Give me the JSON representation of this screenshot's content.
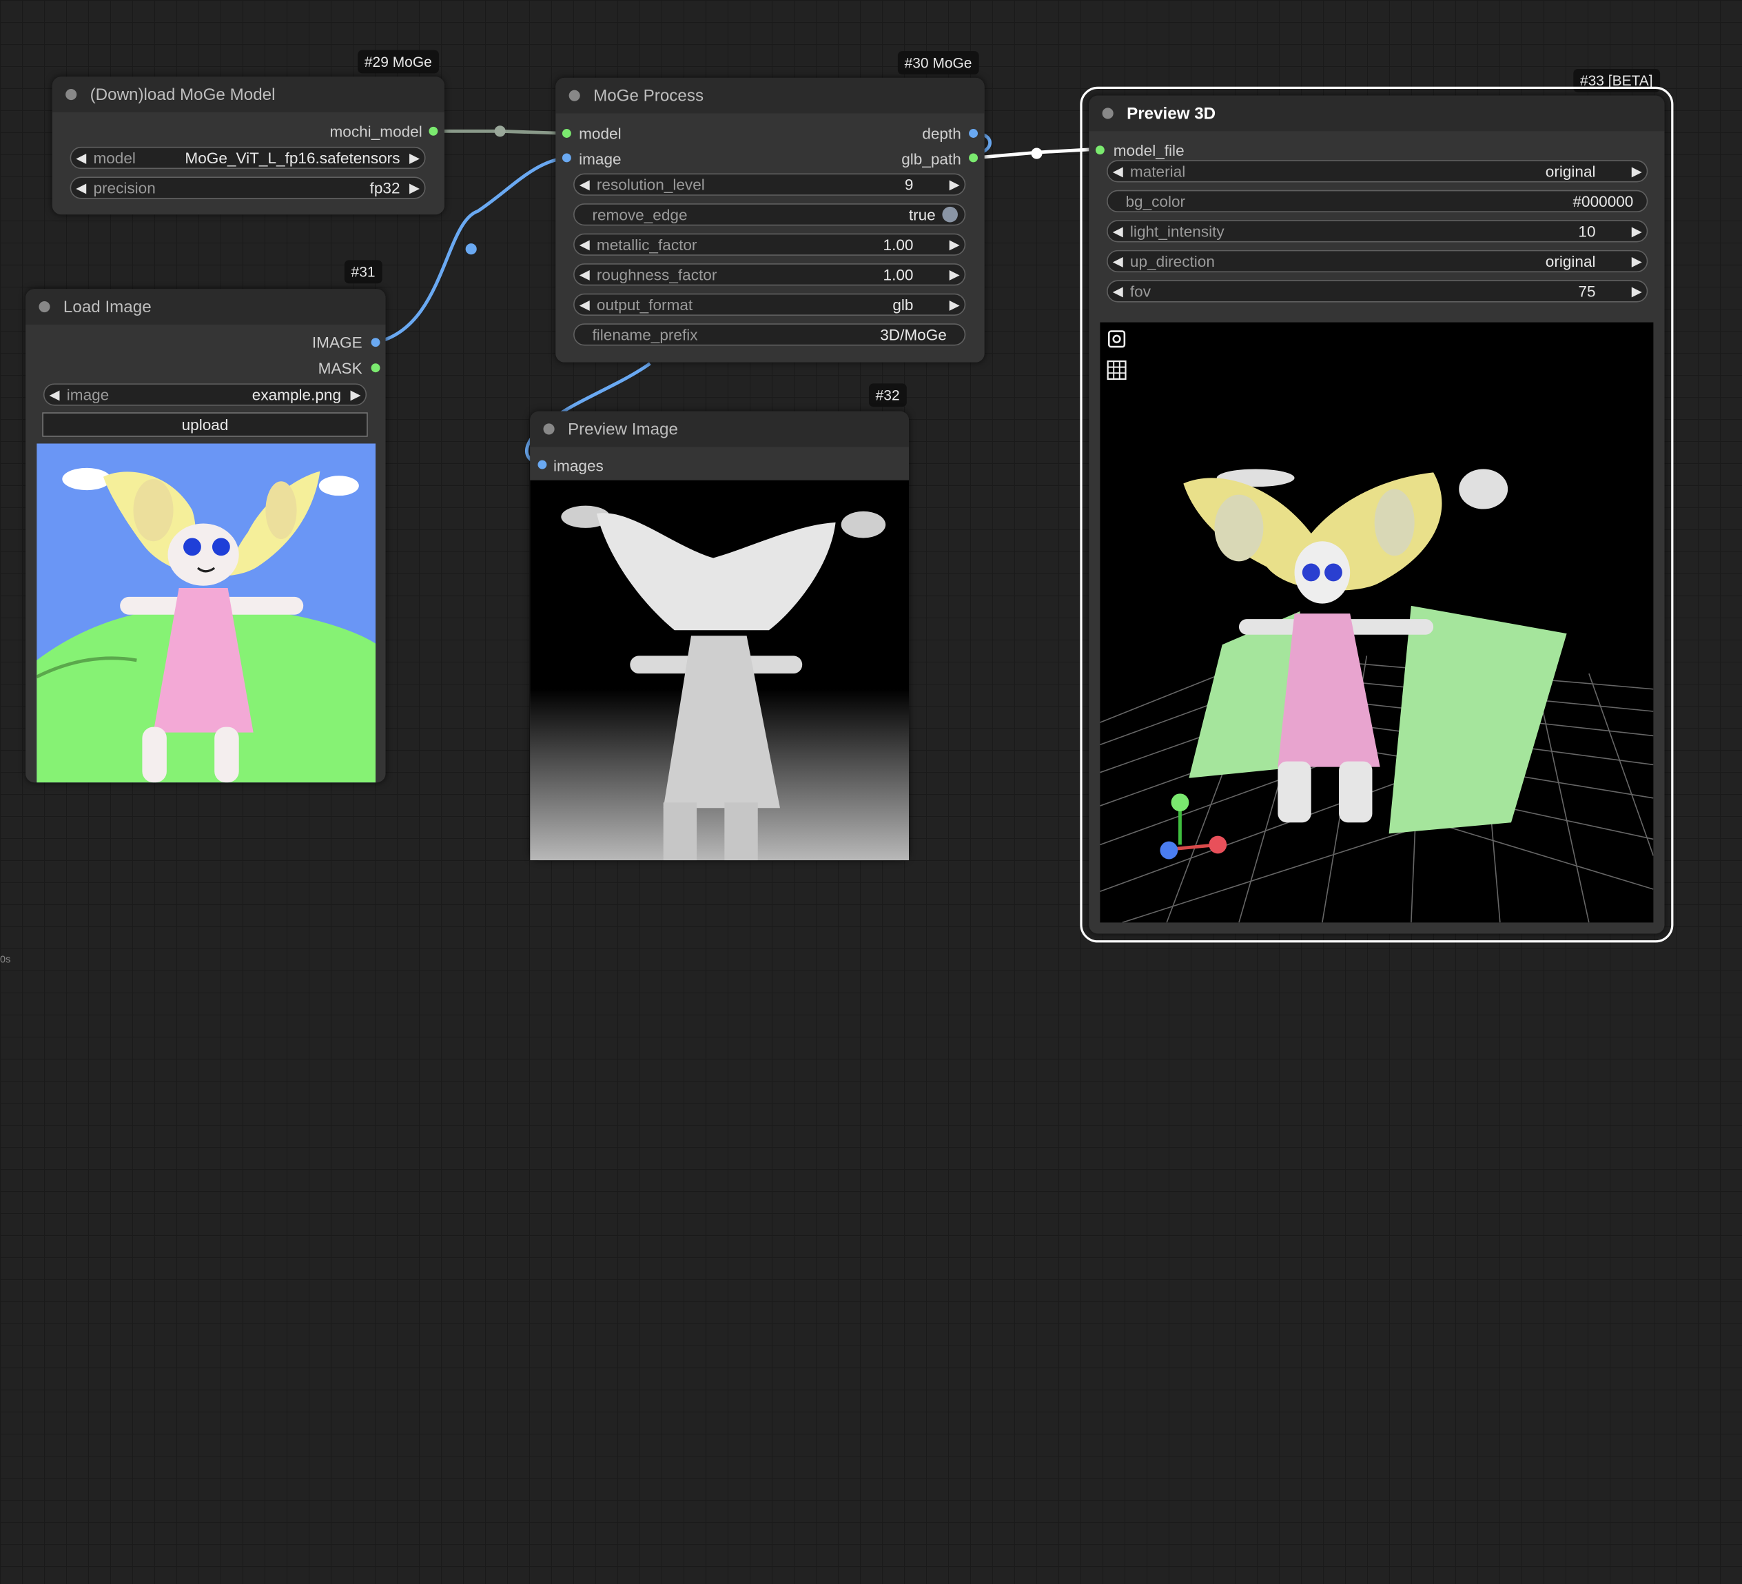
{
  "footer": {
    "text": "0s"
  },
  "nodes": {
    "download_moge": {
      "badge": "#29 MoGe",
      "title": "(Down)load MoGe Model",
      "outputs": [
        "mochi_model"
      ],
      "widgets": [
        {
          "label": "model",
          "value": "MoGe_ViT_L_fp16.safetensors"
        },
        {
          "label": "precision",
          "value": "fp32"
        }
      ]
    },
    "moge_process": {
      "badge": "#30 MoGe",
      "title": "MoGe Process",
      "inputs": [
        "model",
        "image"
      ],
      "outputs": [
        "depth",
        "glb_path"
      ],
      "widgets": [
        {
          "label": "resolution_level",
          "value": "9"
        },
        {
          "label": "remove_edge",
          "value": "true"
        },
        {
          "label": "metallic_factor",
          "value": "1.00"
        },
        {
          "label": "roughness_factor",
          "value": "1.00"
        },
        {
          "label": "output_format",
          "value": "glb"
        },
        {
          "label": "filename_prefix",
          "value": "3D/MoGe"
        }
      ]
    },
    "load_image": {
      "badge": "#31",
      "title": "Load Image",
      "outputs": [
        "IMAGE",
        "MASK"
      ],
      "widgets": [
        {
          "label": "image",
          "value": "example.png"
        }
      ],
      "upload_label": "upload"
    },
    "preview_image": {
      "badge": "#32",
      "title": "Preview Image",
      "inputs": [
        "images"
      ]
    },
    "preview_3d": {
      "badge": "#33 [BETA]",
      "title": "Preview 3D",
      "inputs": [
        "model_file"
      ],
      "widgets": [
        {
          "label": "material",
          "value": "original"
        },
        {
          "label": "bg_color",
          "value": "#000000"
        },
        {
          "label": "light_intensity",
          "value": "10"
        },
        {
          "label": "up_direction",
          "value": "original"
        },
        {
          "label": "fov",
          "value": "75"
        }
      ]
    }
  },
  "colors": {
    "canvas_bg": "#222222",
    "node_bg": "#353535",
    "title_bg": "#2b2b2b",
    "model_slot": "#7bea6f",
    "image_slot": "#6aa9f2",
    "sky": "#6a96f5",
    "grass": "#86f274",
    "dress": "#f3a9d6",
    "hair": "#f5ef9a"
  },
  "icons": [
    "camera-icon",
    "grid-icon",
    "arrow-left-icon",
    "arrow-right-icon"
  ]
}
